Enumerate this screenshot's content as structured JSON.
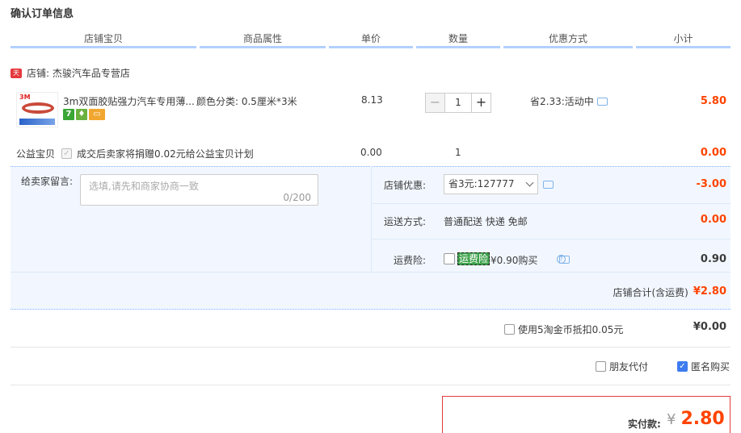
{
  "page_title": "确认订单信息",
  "columns": [
    "店铺宝贝",
    "商品属性",
    "单价",
    "数量",
    "优惠方式",
    "小计"
  ],
  "shop": {
    "icon": "tmall-icon",
    "name": "店铺: 杰骏汽车品专营店"
  },
  "item": {
    "name": "3m双面胶贴强力汽车专用薄...",
    "attr": "颜色分类: 0.5厘米*3米",
    "price": "8.13",
    "qty": "1",
    "minus": "−",
    "plus": "+",
    "promo": "省2.33:活动中",
    "subtotal": "5.80"
  },
  "charity": {
    "label": "公益宝贝",
    "text": "成交后卖家将捐赠0.02元给公益宝贝计划",
    "price": "0.00",
    "qty": "1",
    "subtotal": "0.00"
  },
  "message": {
    "label": "给卖家留言:",
    "placeholder": "选填,请先和商家协商一致",
    "counter": "0/200"
  },
  "discount": {
    "label": "店铺优惠:",
    "selected": "省3元:127777",
    "amount": "-3.00"
  },
  "shipping": {
    "label": "运送方式:",
    "value": "普通配送 快递 免邮",
    "amount": "0.00"
  },
  "insurance": {
    "label": "运费险:",
    "tag": "运费险",
    "price": "¥0.90购买",
    "amount": "0.90"
  },
  "store_total": {
    "label": "店铺合计(含运费)",
    "value": "¥2.80"
  },
  "coin": {
    "label": "使用5淘金币抵扣0.05元",
    "value": "¥0.00"
  },
  "friend_pay": "朋友代付",
  "anonymous": "匿名购买",
  "payment": {
    "label": "实付款:",
    "currency": "¥",
    "value": "2.80"
  },
  "colors": {
    "accent": "#ff4400",
    "header_border": "#b2d1ff",
    "panel_bg": "#f2f7ff",
    "checked": "#3d7bf0"
  }
}
